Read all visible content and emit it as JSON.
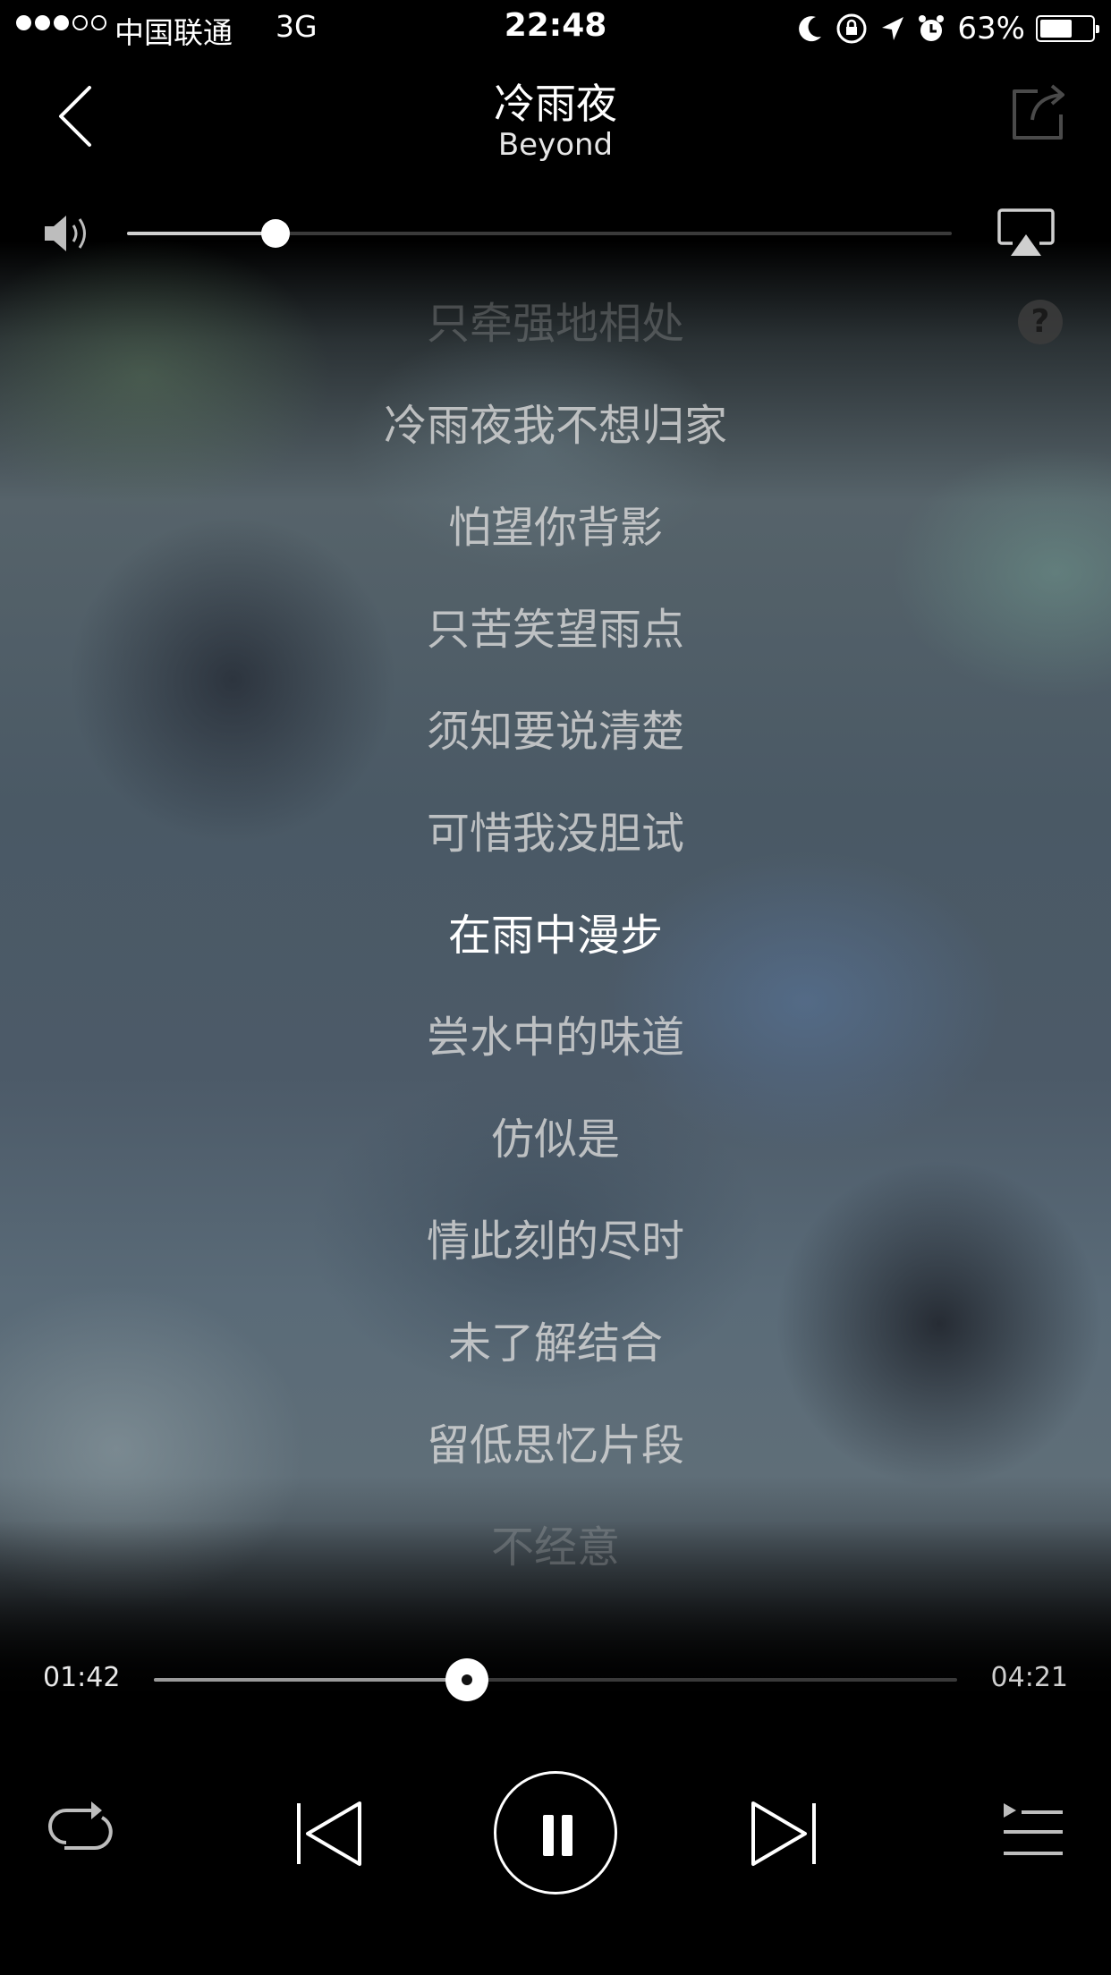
{
  "status_bar": {
    "signal_bars_filled": 3,
    "signal_bars_total": 5,
    "carrier": "中国联通",
    "network": "3G",
    "time": "22:48",
    "battery_percent_text": "63%",
    "battery_level": 0.63,
    "icons": [
      "moon-icon",
      "rotation-lock-icon",
      "location-arrow-icon",
      "alarm-icon",
      "battery-icon"
    ]
  },
  "header": {
    "song_title": "冷雨夜",
    "artist": "Beyond",
    "icons": [
      "back-chevron-icon",
      "share-icon"
    ]
  },
  "volume": {
    "level": 0.18,
    "icons": [
      "speaker-icon",
      "airplay-icon"
    ]
  },
  "help": {
    "label": "?"
  },
  "lyrics": {
    "lines": [
      "只牵强地相处",
      "冷雨夜我不想归家",
      "怕望你背影",
      "只苦笑望雨点",
      "须知要说清楚",
      "可惜我没胆试",
      "在雨中漫步",
      "尝水中的味道",
      "仿似是",
      "情此刻的尽时",
      "未了解结合",
      "留低思忆片段",
      "不经意"
    ],
    "current_index": 6
  },
  "progress": {
    "elapsed": "01:42",
    "total": "04:21",
    "fraction": 0.39
  },
  "controls": {
    "icons": [
      "repeat-icon",
      "previous-track-icon",
      "pause-icon",
      "next-track-icon",
      "playlist-icon"
    ]
  },
  "colors": {
    "background": "#000000",
    "text_primary": "#ffffff",
    "lyric_inactive": "#d7d7d7"
  }
}
